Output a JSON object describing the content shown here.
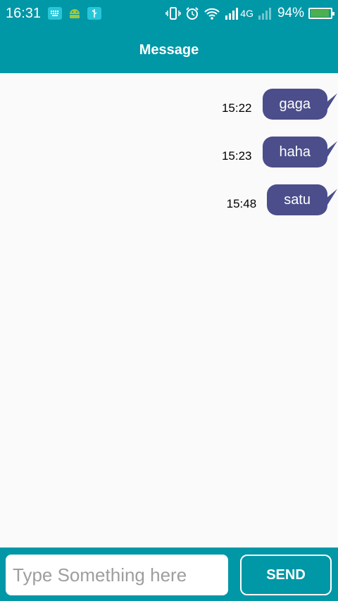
{
  "status_bar": {
    "time": "16:31",
    "network_label": "4G",
    "battery_percent": "94%",
    "battery_level": 0.94,
    "icons": [
      "keyboard-icon",
      "android-icon",
      "usb-icon",
      "vibrate-icon",
      "alarm-icon",
      "wifi-icon",
      "signal-icon",
      "signal-empty-icon",
      "battery-icon"
    ]
  },
  "app_bar": {
    "title": "Message"
  },
  "messages": [
    {
      "time": "15:22",
      "text": "gaga"
    },
    {
      "time": "15:23",
      "text": "haha"
    },
    {
      "time": "15:48",
      "text": "satu"
    }
  ],
  "composer": {
    "placeholder": "Type Something here",
    "value": "",
    "send_label": "SEND"
  },
  "colors": {
    "primary": "#0097a7",
    "bubble": "#4b4e8a",
    "background": "#fafafa",
    "battery": "#4caf50"
  }
}
